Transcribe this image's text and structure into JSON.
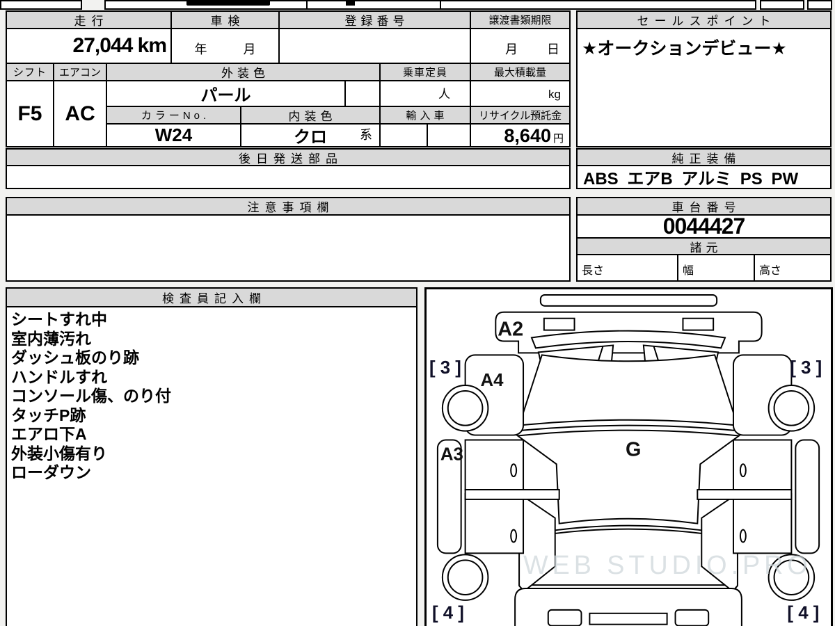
{
  "left_table": {
    "mileage_label": "走行",
    "mileage_value": "27,044 km",
    "inspection_label": "車検",
    "inspection_year": "年",
    "inspection_month": "月",
    "registration_label": "登録番号",
    "transfer_label": "譲渡書類期限",
    "transfer_month": "月",
    "transfer_day": "日",
    "shift_label": "シフト",
    "shift_value": "F5",
    "aircon_label": "エアコン",
    "aircon_value": "AC",
    "exterior_label": "外装色",
    "exterior_value": "パール",
    "capacity_label": "乗車定員",
    "capacity_unit": "人",
    "maxload_label": "最大積載量",
    "maxload_unit": "kg",
    "colorno_label": "カラーNo.",
    "colorno_value": "W24",
    "interior_label": "内装色",
    "interior_value": "クロ",
    "interior_suffix": "系",
    "import_label": "輸入車",
    "recycle_label": "リサイクル預託金",
    "recycle_value": "8,640",
    "recycle_unit": "円",
    "later_parts_label": "後日発送部品",
    "notes_label": "注意事項欄"
  },
  "right_panel": {
    "sales_label": "セールスポイント",
    "sales_value": "★オークションデビュー★",
    "equipment_label": "純正装備",
    "equipment_value": "ABS エアB アルミ PS PW",
    "chassis_label": "車台番号",
    "chassis_value": "0044427",
    "spec_label": "諸元",
    "spec_length": "長さ",
    "spec_width": "幅",
    "spec_height": "高さ"
  },
  "inspector": {
    "label": "検査員記入欄",
    "notes": [
      "シートすれ中",
      "室内薄汚れ",
      "ダッシュ板のり跡",
      "ハンドルすれ",
      "コンソール傷、のり付",
      "タッチP跡",
      "エアロ下A",
      "外装小傷有り",
      "ローダウン"
    ]
  },
  "diagram": {
    "labels": {
      "a2": "A2",
      "a4": "A4",
      "a3": "A3",
      "g": "G",
      "grade3_left": "[ 3 ]",
      "grade3_right": "[ 3 ]",
      "grade4_left": "[ 4 ]",
      "grade4_right": "[ 4 ]"
    },
    "watermark": "WEB STUDIO.PRO"
  },
  "colors": {
    "header_bg": "#d9d9d9",
    "border": "#000000",
    "page_bg": "#f2f2f0",
    "grade_text": "#101028",
    "watermark": "#ccd5d9"
  }
}
